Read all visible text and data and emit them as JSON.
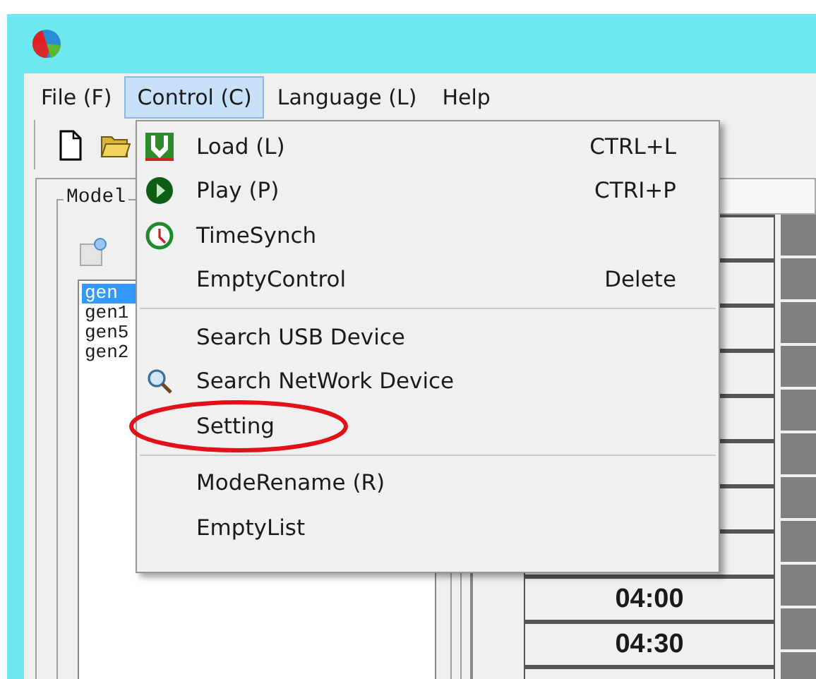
{
  "menubar": [
    {
      "label": "File (F)",
      "selected": false
    },
    {
      "label": "Control (C)",
      "selected": true
    },
    {
      "label": "Language (L)",
      "selected": false
    },
    {
      "label": "Help",
      "selected": false
    }
  ],
  "model_group": {
    "title": "Model",
    "items": [
      {
        "label": "gen",
        "selected": true
      },
      {
        "label": "gen1",
        "selected": false
      },
      {
        "label": "gen5",
        "selected": false
      },
      {
        "label": "gen2",
        "selected": false
      }
    ]
  },
  "time_cells": [
    "04:00",
    "04:30"
  ],
  "menu": [
    {
      "kind": "load",
      "label": "Load (L)",
      "shortcut": "CTRL+L"
    },
    {
      "kind": "play",
      "label": "Play (P)",
      "shortcut": "CTRI+P"
    },
    {
      "kind": "clock",
      "label": "TimeSynch"
    },
    {
      "kind": "item",
      "label": "EmptyControl",
      "shortcut": "Delete"
    },
    {
      "kind": "separator"
    },
    {
      "kind": "item",
      "label": "Search USB Device"
    },
    {
      "kind": "search",
      "label": "Search NetWork Device"
    },
    {
      "kind": "item",
      "label": "Setting",
      "circled": true
    },
    {
      "kind": "separator"
    },
    {
      "kind": "item",
      "label": "ModeRename (R)"
    },
    {
      "kind": "item",
      "label": "EmptyList"
    }
  ]
}
